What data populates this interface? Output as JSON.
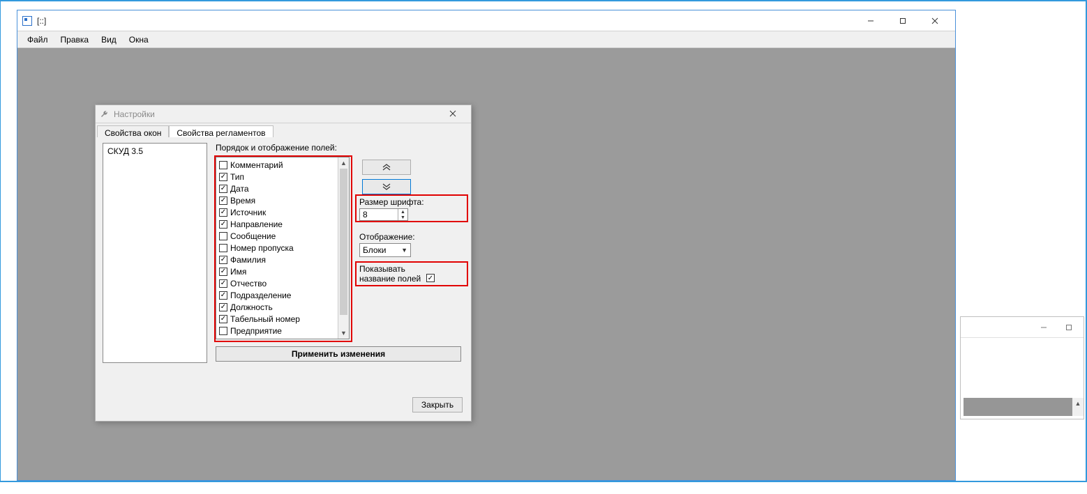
{
  "main_window": {
    "title": "[::]",
    "menu": {
      "file": "Файл",
      "edit": "Правка",
      "view": "Вид",
      "windows": "Окна"
    }
  },
  "dialog": {
    "title": "Настройки",
    "tabs": {
      "windows": "Свойства окон",
      "regulations": "Свойства регламентов"
    },
    "left_list": {
      "item0": "СКУД 3.5"
    },
    "fields_label": "Порядок и отображение полей:",
    "fields": [
      {
        "label": "Комментарий",
        "checked": false
      },
      {
        "label": "Тип",
        "checked": true
      },
      {
        "label": "Дата",
        "checked": true
      },
      {
        "label": "Время",
        "checked": true
      },
      {
        "label": "Источник",
        "checked": true
      },
      {
        "label": "Направление",
        "checked": true
      },
      {
        "label": "Сообщение",
        "checked": false
      },
      {
        "label": "Номер пропуска",
        "checked": false
      },
      {
        "label": "Фамилия",
        "checked": true
      },
      {
        "label": "Имя",
        "checked": true
      },
      {
        "label": "Отчество",
        "checked": true
      },
      {
        "label": "Подразделение",
        "checked": true
      },
      {
        "label": "Должность",
        "checked": true
      },
      {
        "label": "Табельный номер",
        "checked": true
      },
      {
        "label": "Предприятие",
        "checked": false
      }
    ],
    "font_size": {
      "label": "Размер шрифта:",
      "value": "8"
    },
    "display": {
      "label": "Отображение:",
      "value": "Блоки"
    },
    "show_field_names": {
      "line1": "Показывать",
      "line2": "название полей",
      "checked": true
    },
    "apply_label": "Применить изменения",
    "close_label": "Закрыть"
  }
}
